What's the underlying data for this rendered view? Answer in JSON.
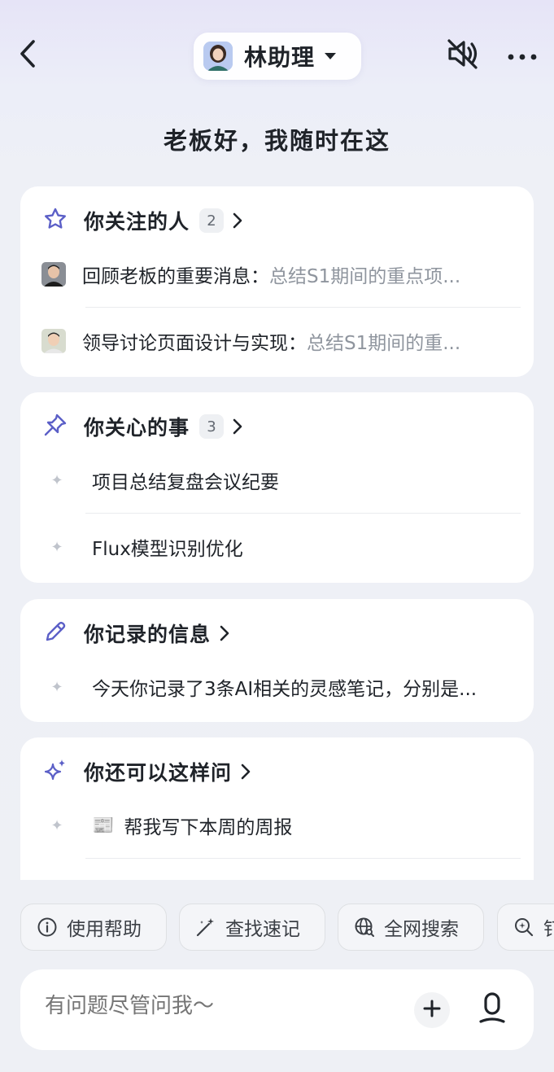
{
  "header": {
    "assistant_name": "林助理",
    "greeting": "老板好，我随时在这"
  },
  "sections": {
    "people": {
      "title": "你关注的人",
      "count": "2",
      "items": [
        {
          "title": "回顾老板的重要消息：",
          "summary": "总结S1期间的重点项..."
        },
        {
          "title": "领导讨论页面设计与实现：",
          "summary": "总结S1期间的重..."
        }
      ]
    },
    "matters": {
      "title": "你关心的事",
      "count": "3",
      "items": [
        "项目总结复盘会议纪要",
        "Flux模型识别优化"
      ]
    },
    "notes": {
      "title": "你记录的信息",
      "items": [
        "今天你记录了3条AI相关的灵感笔记，分别是..."
      ]
    },
    "suggest": {
      "title": "你还可以这样问",
      "items": [
        {
          "emoji": "📰",
          "text": "帮我写下本周的周报"
        }
      ]
    }
  },
  "chips": [
    "使用帮助",
    "查找速记",
    "全网搜索",
    "钉"
  ],
  "composer": {
    "placeholder": "有问题尽管问我～"
  },
  "icons": {
    "back": "back-arrow-icon",
    "mute": "speaker-muted-icon",
    "more": "more-dots-icon",
    "star": "star-outline-icon",
    "pin": "pin-icon",
    "pencil": "pencil-icon",
    "sparkle": "sparkle-icon",
    "info": "info-circle-icon",
    "magic": "magic-wand-icon",
    "globe": "globe-search-icon",
    "plus": "plus-icon",
    "mic": "microphone-icon"
  },
  "colors": {
    "accent_icon": "#5b5fc7",
    "text_primary": "#1f2329",
    "text_secondary": "#8f959e"
  }
}
